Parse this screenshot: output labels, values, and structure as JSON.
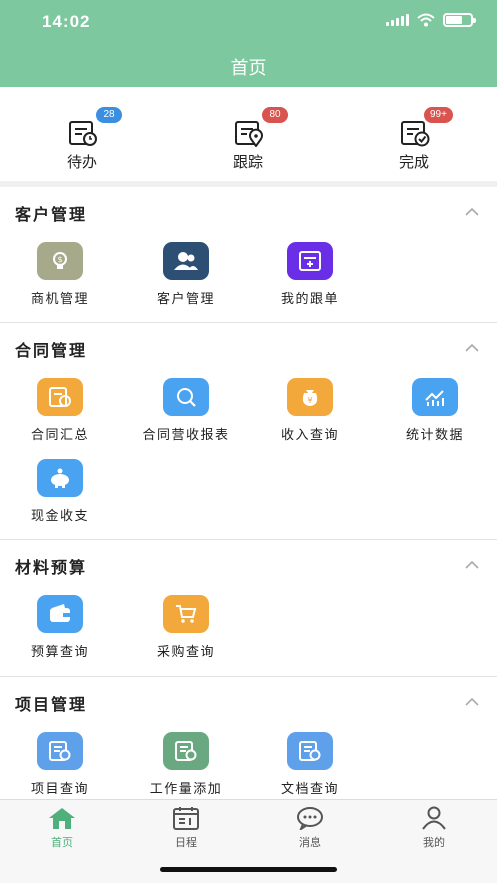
{
  "status_bar": {
    "time": "14:02"
  },
  "header": {
    "title": "首页"
  },
  "stats": [
    {
      "label": "待办",
      "badge": "28",
      "badge_color": "#3a8fe0",
      "icon": "todo-list-clock-icon"
    },
    {
      "label": "跟踪",
      "badge": "80",
      "badge_color": "#d9534f",
      "icon": "track-location-icon"
    },
    {
      "label": "完成",
      "badge": "99+",
      "badge_color": "#d9534f",
      "icon": "done-check-icon"
    }
  ],
  "sections": [
    {
      "title": "客户管理",
      "items": [
        {
          "label": "商机管理",
          "color": "#a6a98a",
          "icon": "opportunity-bulb-icon"
        },
        {
          "label": "客户管理",
          "color": "#2e4f74",
          "icon": "customers-icon"
        },
        {
          "label": "我的跟单",
          "color": "#6a2ee6",
          "icon": "add-order-icon"
        }
      ]
    },
    {
      "title": "合同管理",
      "items": [
        {
          "label": "合同汇总",
          "color": "#f3a83b",
          "icon": "contract-summary-icon"
        },
        {
          "label": "合同营收报表",
          "color": "#4aa3f0",
          "icon": "search-report-icon"
        },
        {
          "label": "收入查询",
          "color": "#f3a83b",
          "icon": "income-bag-icon"
        },
        {
          "label": "统计数据",
          "color": "#4aa3f0",
          "icon": "statistics-chart-icon"
        },
        {
          "label": "现金收支",
          "color": "#4aa3f0",
          "icon": "piggy-bank-icon"
        }
      ]
    },
    {
      "title": "材料预算",
      "items": [
        {
          "label": "预算查询",
          "color": "#4aa3f0",
          "icon": "wallet-icon"
        },
        {
          "label": "采购查询",
          "color": "#f3a83b",
          "icon": "shopping-cart-icon"
        }
      ]
    },
    {
      "title": "项目管理",
      "items": [
        {
          "label": "项目查询",
          "color": "#5fa0ea",
          "icon": "project-doc-icon"
        },
        {
          "label": "工作量添加",
          "color": "#6aa882",
          "icon": "workload-doc-icon"
        },
        {
          "label": "文档查询",
          "color": "#5fa0ea",
          "icon": "document-doc-icon"
        }
      ]
    }
  ],
  "tabbar": [
    {
      "label": "首页",
      "icon": "home-icon",
      "active": true
    },
    {
      "label": "日程",
      "icon": "calendar-icon",
      "active": false
    },
    {
      "label": "消息",
      "icon": "message-icon",
      "active": false
    },
    {
      "label": "我的",
      "icon": "profile-icon",
      "active": false
    }
  ],
  "colors": {
    "header": "#7ec8a0",
    "active_tab": "#4fb07c"
  }
}
